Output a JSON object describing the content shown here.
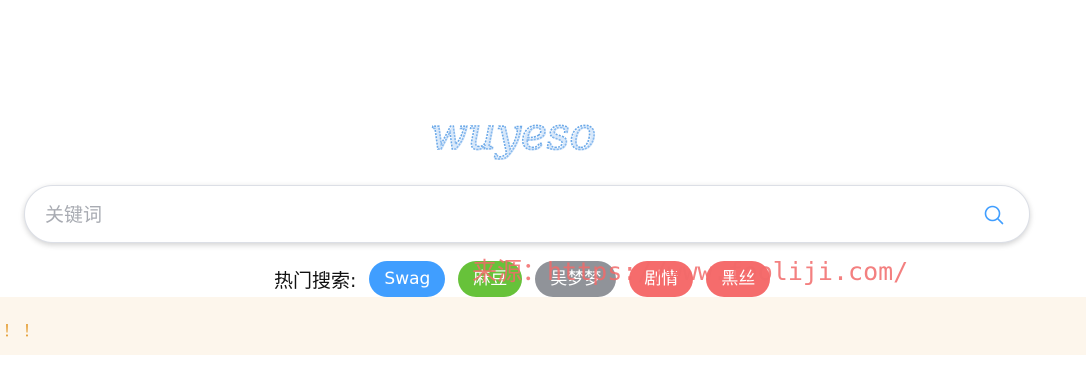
{
  "logo": {
    "text": "wuyeso"
  },
  "search": {
    "placeholder": "关键词",
    "value": "",
    "button_icon": "search-icon",
    "icon_color": "#409eff"
  },
  "hot_search": {
    "label": "热门搜索:",
    "tags": [
      {
        "label": "Swag",
        "color": "#409eff"
      },
      {
        "label": "麻豆",
        "color": "#67c23a"
      },
      {
        "label": "吴梦梦",
        "color": "#909399"
      },
      {
        "label": "剧情",
        "color": "#f56c6c"
      },
      {
        "label": "黑丝",
        "color": "#f56c6c"
      }
    ]
  },
  "watermark": {
    "text": "来源：https://www.fooliji.com/"
  },
  "notice": {
    "text": "！！",
    "background": "#fdf6ec",
    "color": "#e6a23c"
  }
}
